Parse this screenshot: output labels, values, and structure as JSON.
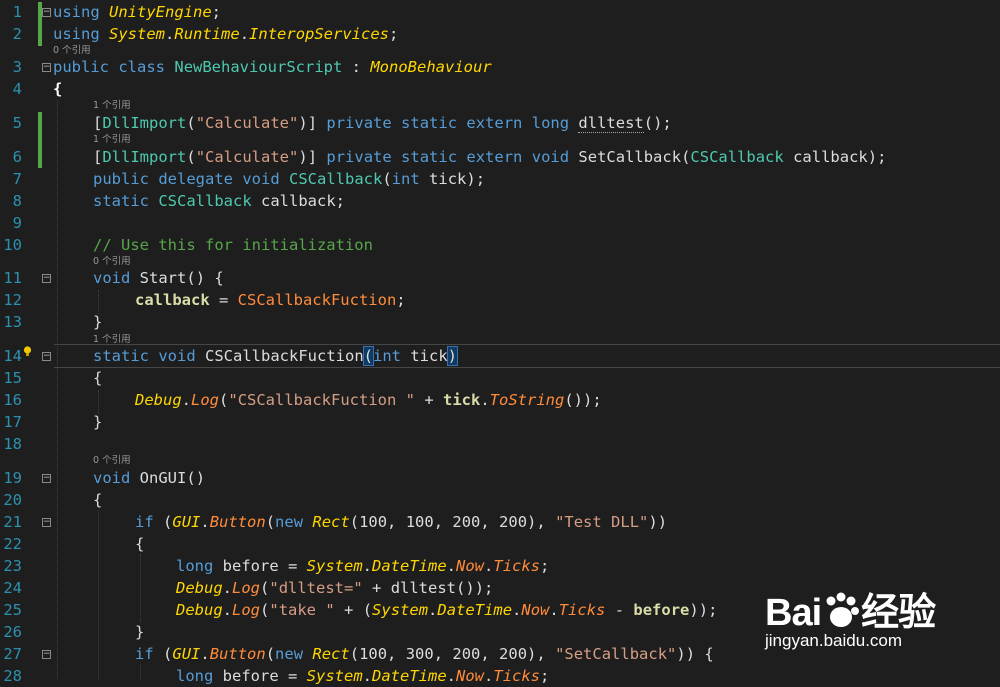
{
  "editor": {
    "ref_labels": {
      "r0": "0 个引用",
      "r1": "1 个引用"
    },
    "lines": [
      {
        "n": "1"
      },
      {
        "n": "2"
      },
      {
        "n": "3"
      },
      {
        "n": "4"
      },
      {
        "n": "5"
      },
      {
        "n": "6"
      },
      {
        "n": "7"
      },
      {
        "n": "8"
      },
      {
        "n": "9"
      },
      {
        "n": "10"
      },
      {
        "n": "11"
      },
      {
        "n": "12"
      },
      {
        "n": "13"
      },
      {
        "n": "14"
      },
      {
        "n": "15"
      },
      {
        "n": "16"
      },
      {
        "n": "17"
      },
      {
        "n": "18"
      },
      {
        "n": "19"
      },
      {
        "n": "20"
      },
      {
        "n": "21"
      },
      {
        "n": "22"
      },
      {
        "n": "23"
      },
      {
        "n": "24"
      },
      {
        "n": "25"
      },
      {
        "n": "26"
      },
      {
        "n": "27"
      },
      {
        "n": "28"
      }
    ],
    "tokens": {
      "using": "using",
      "UnityEngine": "UnityEngine",
      "semicolon": ";",
      "System": "System",
      "dot": ".",
      "Runtime": "Runtime",
      "InteropServices": "InteropServices",
      "public": "public",
      "class": "class",
      "NewBehaviourScript": "NewBehaviourScript",
      "colon": " : ",
      "MonoBehaviour": "MonoBehaviour",
      "open_brace": "{",
      "close_brace": "}",
      "lbracket": "[",
      "DllImport": "DllImport",
      "lparen": "(",
      "Calculate": "\"Calculate\"",
      "rparen": ")",
      "rbracket": "]",
      "private": "private",
      "static": "static",
      "extern": "extern",
      "long": "long",
      "dlltest": "dlltest",
      "void": "void",
      "SetCallback": "SetCallback",
      "CSCallback": "CSCallback",
      "callback": "callback",
      "delegate": "delegate",
      "int": "int",
      "tick": "tick",
      "comment": "// Use this for initialization",
      "Start": "Start",
      "assign": " = ",
      "CSCallbackFuction": "CSCallbackFuction",
      "Debug": "Debug",
      "Log": "Log",
      "str_cscb": "\"CSCallbackFuction \"",
      "plus": " + ",
      "ToString": "ToString",
      "OnGUI": "OnGUI",
      "if": "if",
      "GUI": "GUI",
      "Button": "Button",
      "new": "new",
      "Rect": "Rect",
      "nums1": "100, 100, 200, 200",
      "nums2": "100, 300, 200, 200",
      "comma": ", ",
      "str_test": "\"Test DLL\"",
      "str_setcb": "\"SetCallback\"",
      "before": "before",
      "DateTime": "DateTime",
      "Now": "Now",
      "Ticks": "Ticks",
      "str_dlltest": "\"dlltest=\"",
      "str_take": "\"take \"",
      "minus": " - "
    }
  },
  "watermark": {
    "logo_text": "Bai",
    "logo_text2": "经验",
    "url": "jingyan.baidu.com"
  }
}
